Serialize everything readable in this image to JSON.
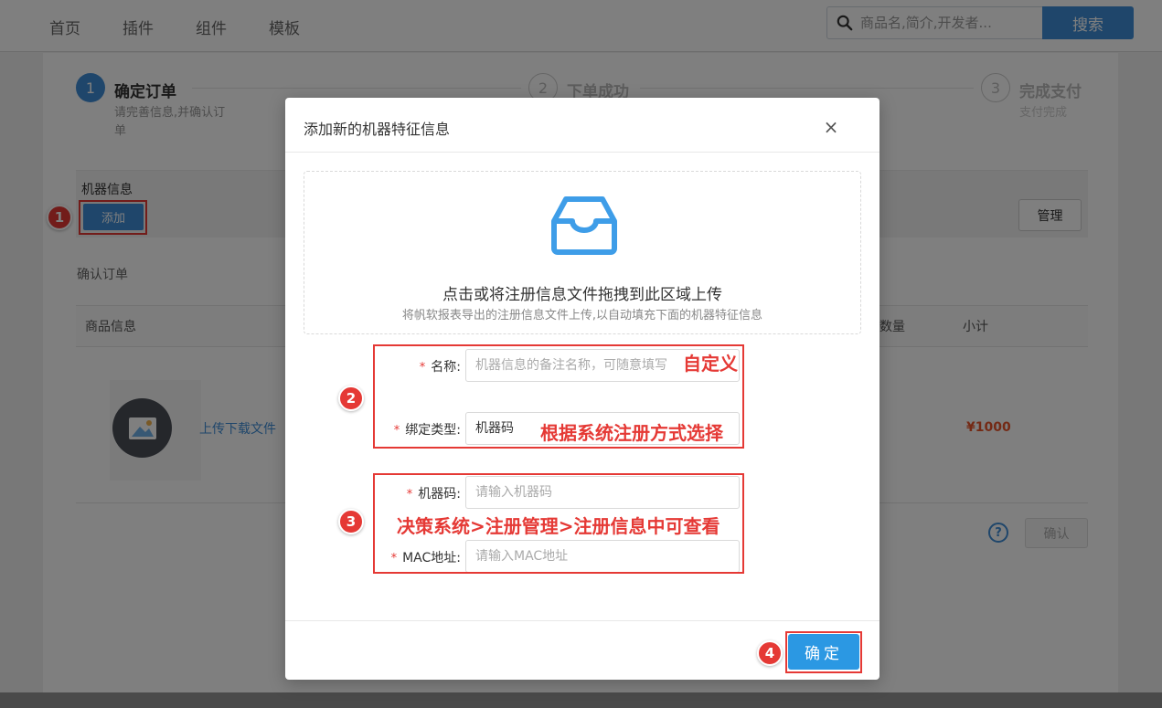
{
  "nav": {
    "items": [
      "首页",
      "插件",
      "组件",
      "模板"
    ]
  },
  "search": {
    "placeholder": "商品名,简介,开发者...",
    "button": "搜索"
  },
  "steps": [
    {
      "num": "1",
      "title": "确定订单",
      "desc1": "请完善信息,并确认订",
      "desc2": "单"
    },
    {
      "num": "2",
      "title": "下单成功"
    },
    {
      "num": "3",
      "title": "完成支付",
      "desc1": "支付完成"
    }
  ],
  "machine": {
    "title": "机器信息",
    "add_label": "添加",
    "manage_label": "管理"
  },
  "order": {
    "title": "确认订单",
    "headers": {
      "product": "商品信息",
      "qty": "数量",
      "subtotal": "小计"
    },
    "product_link": "上传下载文件",
    "price": "¥1000",
    "help": "?",
    "confirm_label": "确认"
  },
  "modal": {
    "title": "添加新的机器特征信息",
    "close": "×",
    "upload_main": "点击或将注册信息文件拖拽到此区域上传",
    "upload_sub": "将帆软报表导出的注册信息文件上传,以自动填充下面的机器特征信息",
    "fields": {
      "name": {
        "label": "名称:",
        "placeholder": "机器信息的备注名称，可随意填写"
      },
      "bind_type": {
        "label": "绑定类型:",
        "value": "机器码"
      },
      "machine_code": {
        "label": "机器码:",
        "placeholder": "请输入机器码"
      },
      "mac": {
        "label": "MAC地址:",
        "placeholder": "请输入MAC地址"
      }
    },
    "required_mark": "*",
    "ok_label": "确定"
  },
  "annotations": {
    "badges": [
      "1",
      "2",
      "3",
      "4"
    ],
    "custom": "自定义",
    "choose_by": "根据系统注册方式选择",
    "where_to_find": "决策系统>注册管理>注册信息中可查看"
  },
  "colors": {
    "primary": "#3e8dd6",
    "annotation": "#e53935",
    "price": "#e8542a"
  }
}
